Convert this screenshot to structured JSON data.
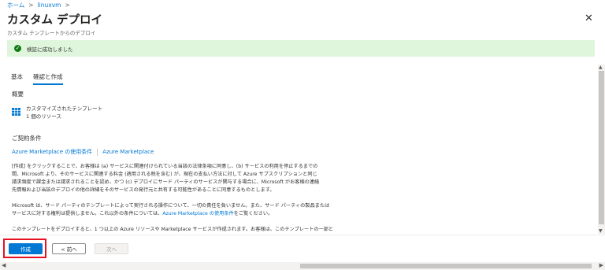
{
  "breadcrumb": [
    "ホーム",
    "linuxvm"
  ],
  "title": "カスタム デプロイ",
  "more_label": "...",
  "subtitle": "カスタム テンプレートからのデプロイ",
  "close_label": "✕",
  "status": {
    "text": "検証に成功しました",
    "icon": "check-circle-icon",
    "color": "#dff6dd"
  },
  "tabs": [
    {
      "label": "基本"
    },
    {
      "label": "確認と作成"
    }
  ],
  "summary": {
    "heading": "概要",
    "template_name": "カスタマイズされたテンプレート",
    "resource_count": "1 個のリソース"
  },
  "terms": {
    "heading": "ご契約条件",
    "link1": "Azure Marketplace の使用条件",
    "link2": "Azure Marketplace",
    "para1_lines": [
      "[作成] をクリックすることで、お客様は (a) サービスに関連付けられている当該の法律条項に同意し、(b) サービスの利用を停止するまでの",
      "間、Microsoft より、そのサービスに関連する料金 (適用される税を含む) が、現在の支払い方法に対して Azure サブスクリプションと同じ",
      "請求頻度で課金または請求されることを認め、かつ (c) デプロイにサード パーティのサービスが関与する場合に、Microsoft がお客様の連絡",
      "先情報および当該のデプロイの他の詳細をそのサービスの発行元と共有する可能性があることに同意するものとします。"
    ],
    "para2_line1": "Microsoft は、サード パーティのテンプレートによって実行される操作について、一切の責任を負いません。また、サード パーティの製品または",
    "para2_line2_before": "サービスに対する権利は提供しません。これ以外の条件については、",
    "para2_link": "Azure Marketplace の使用条件",
    "para2_line2_after": "をご覧ください。",
    "para3": "このテンプレートをデプロイすると、1 つ以上の Azure リソースや Marketplace サービスが作成されます。お客様は、このテンプレートの一部と"
  },
  "footer": {
    "create_label": "作成",
    "prev_label": "< 前へ",
    "next_label": "次へ"
  },
  "accent_color": "#0078d4",
  "highlight_color": "#e81123"
}
